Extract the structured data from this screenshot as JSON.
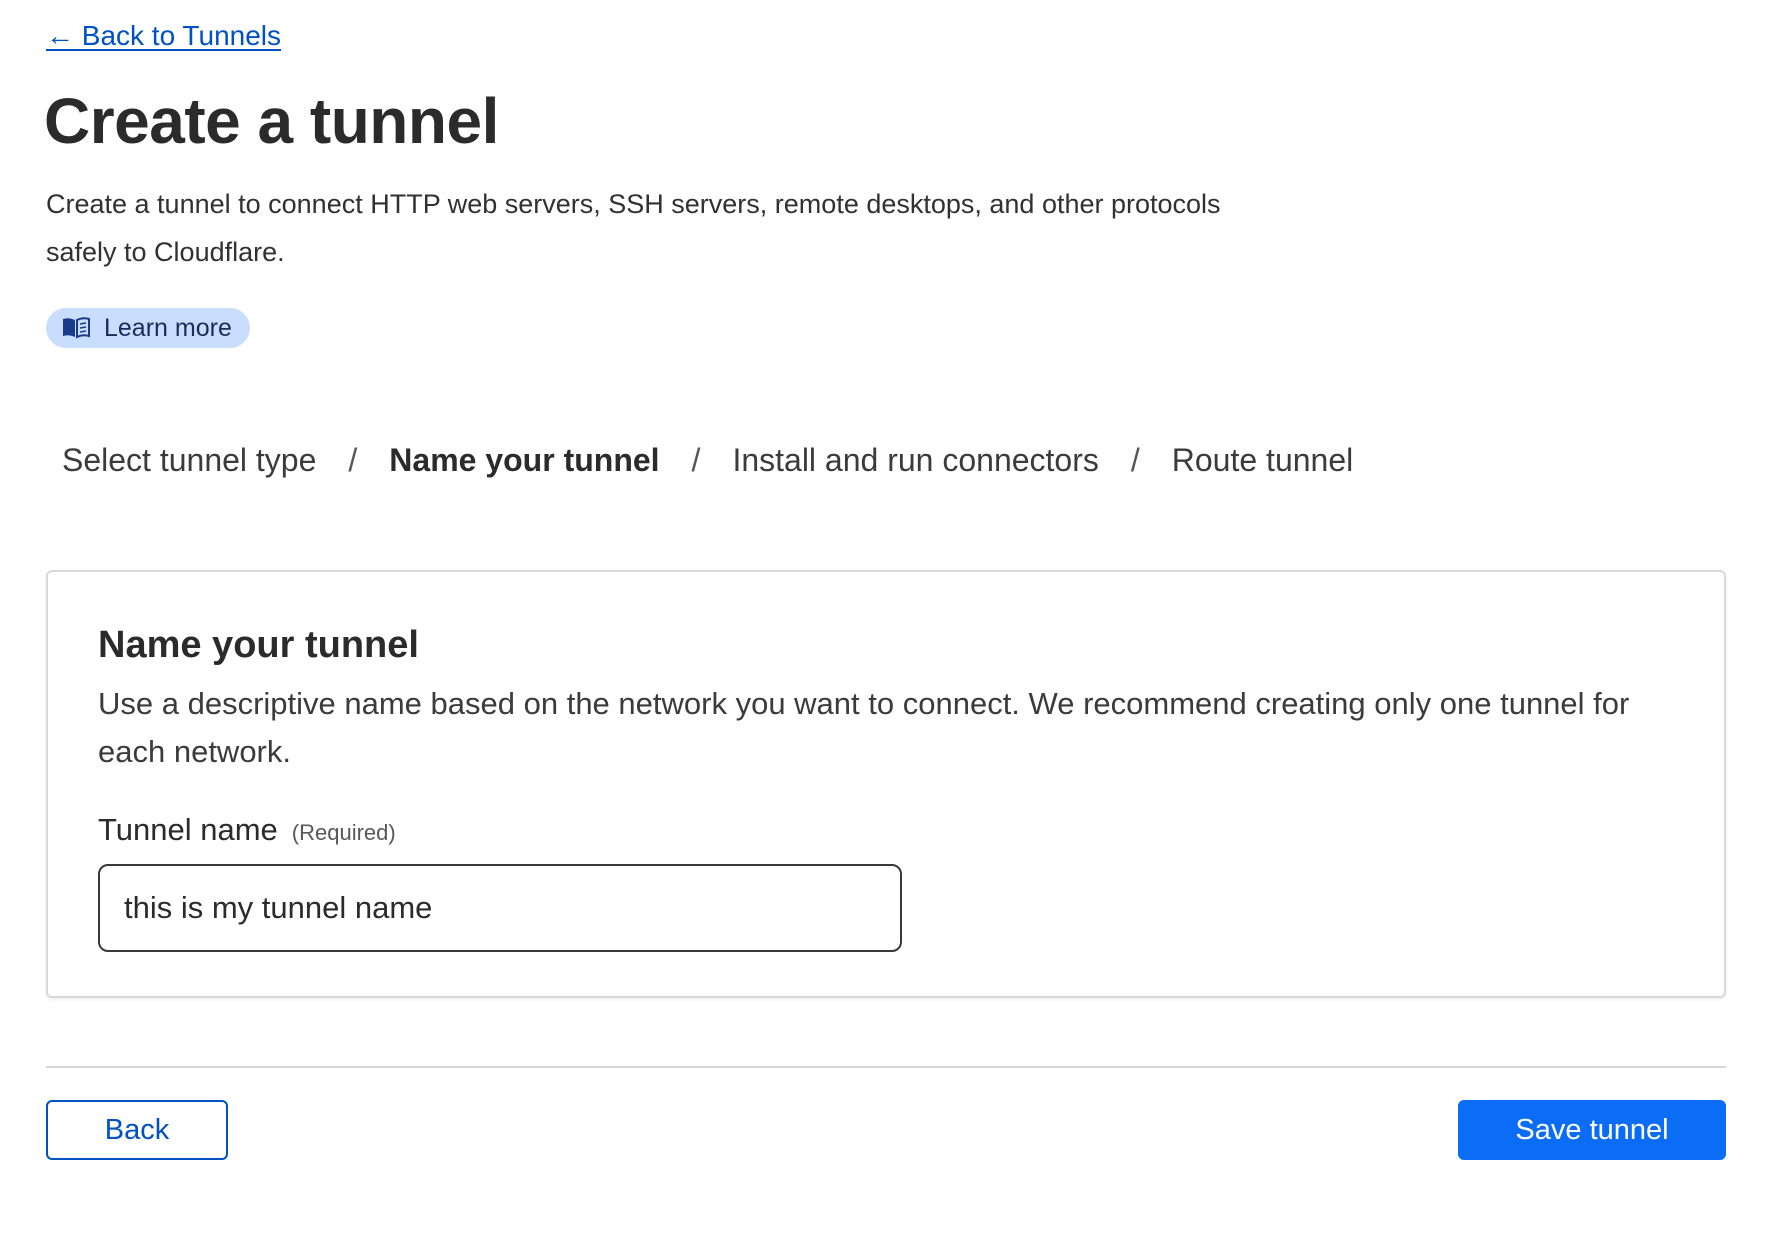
{
  "nav": {
    "back_link": "← Back to Tunnels"
  },
  "header": {
    "title": "Create a tunnel",
    "description": "Create a tunnel to connect HTTP web servers, SSH servers, remote desktops, and other protocols safely to Cloudflare.",
    "learn_more": "Learn more"
  },
  "steps": [
    {
      "label": "Select tunnel type",
      "active": false
    },
    {
      "label": "Name your tunnel",
      "active": true
    },
    {
      "label": "Install and run connectors",
      "active": false
    },
    {
      "label": "Route tunnel",
      "active": false
    }
  ],
  "step_separator": "/",
  "card": {
    "title": "Name your tunnel",
    "description": "Use a descriptive name based on the network you want to connect. We recommend creating only one tunnel for each network.",
    "field_label": "Tunnel name",
    "field_required": "(Required)",
    "field_value": "this is my tunnel name"
  },
  "footer": {
    "back_label": "Back",
    "save_label": "Save tunnel"
  },
  "colors": {
    "link": "#0051c3",
    "primary": "#0b6cf5",
    "learn_more_bg": "#c9ddff"
  },
  "icons": {
    "learn_more": "book-icon"
  }
}
